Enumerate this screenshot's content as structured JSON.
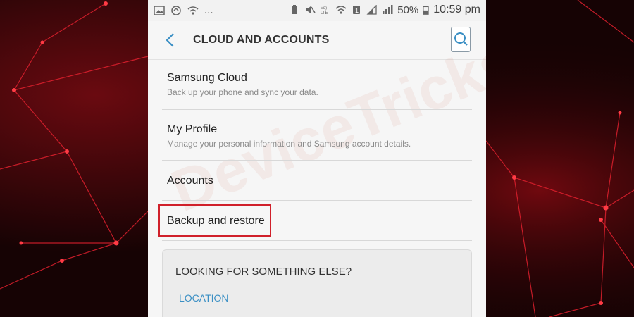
{
  "status_bar": {
    "dots": "...",
    "battery_percent": "50%",
    "time": "10:59 pm"
  },
  "app_bar": {
    "title": "CLOUD AND ACCOUNTS"
  },
  "menu": {
    "items": [
      {
        "title": "Samsung Cloud",
        "subtitle": "Back up your phone and sync your data."
      },
      {
        "title": "My Profile",
        "subtitle": "Manage your personal information and Samsung account details."
      },
      {
        "title": "Accounts"
      },
      {
        "title": "Backup and restore",
        "highlighted": true
      }
    ]
  },
  "suggestion_card": {
    "title": "LOOKING FOR SOMETHING ELSE?",
    "link": "LOCATION"
  },
  "watermark": "DeviceTricks",
  "colors": {
    "highlight": "#d0202a",
    "link": "#3a8fc4",
    "background_red": "#c01020"
  }
}
